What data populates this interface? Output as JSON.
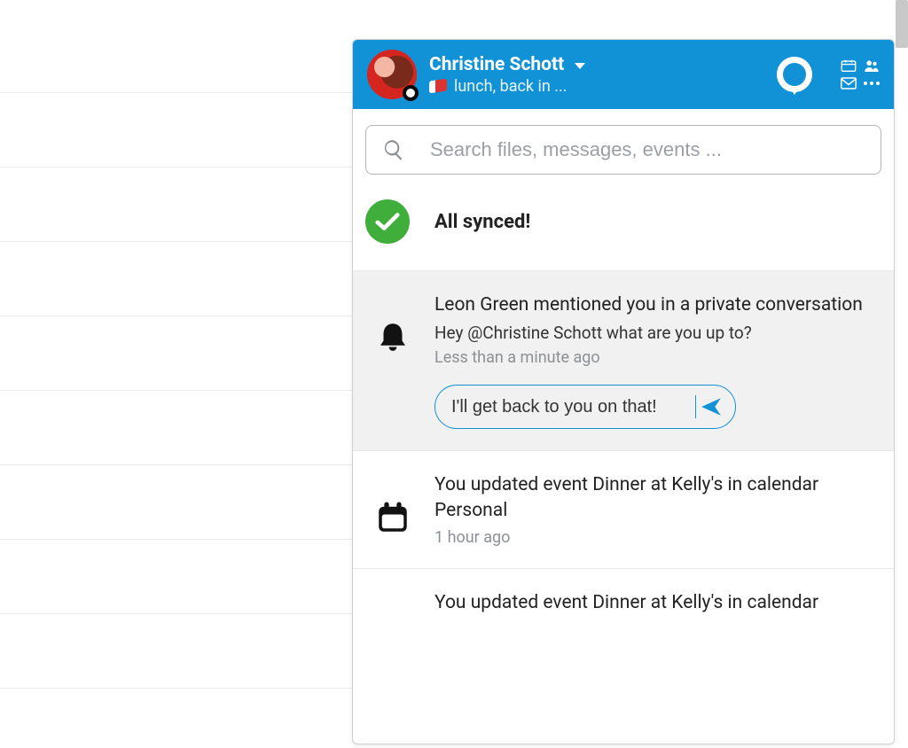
{
  "header": {
    "user_name": "Christine Schott",
    "status_text": "lunch, back in ...",
    "icons": {
      "logo": "quill-chat-icon",
      "calendar": "calendar-icon",
      "people": "people-icon",
      "mail": "mail-icon",
      "more": "more-icon"
    }
  },
  "search": {
    "placeholder": "Search files, messages, events ..."
  },
  "sync": {
    "label": "All synced!"
  },
  "feed": [
    {
      "icon": "bell-icon",
      "highlight": true,
      "title": "Leon Green mentioned you in a private conversation",
      "preview": "Hey @Christine Schott what are you up to?",
      "meta": "Less than a minute ago",
      "reply_value": "I'll get back to you on that!"
    },
    {
      "icon": "calendar-solid-icon",
      "highlight": false,
      "title": "You updated event Dinner at Kelly's in calendar Personal",
      "meta": "1 hour ago"
    },
    {
      "icon": "",
      "highlight": false,
      "partial": true,
      "title": "You updated event Dinner at Kelly's in calendar"
    }
  ]
}
